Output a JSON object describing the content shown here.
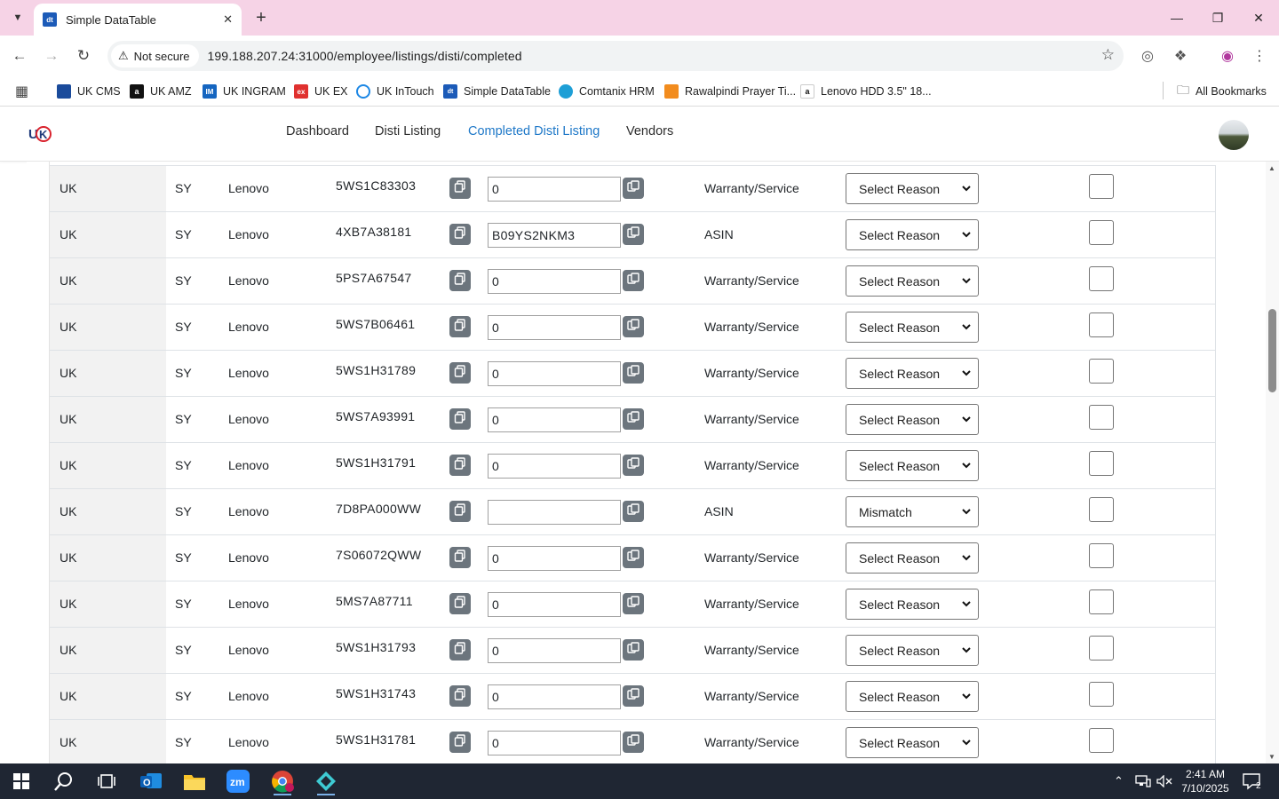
{
  "browser": {
    "tab_title": "Simple DataTable",
    "tab_favicon": "dt",
    "address_security": "Not secure",
    "url": "199.188.207.24:31000/employee/listings/disti/completed"
  },
  "bookmarks": [
    {
      "label": "UK CMS",
      "icon": "uk-cms-icon",
      "color": "#1a4b9b",
      "glyph": "■"
    },
    {
      "label": "UK AMZ",
      "icon": "amazon-icon",
      "color": "#111111",
      "glyph": "a"
    },
    {
      "label": "UK INGRAM",
      "icon": "ingram-icon",
      "color": "#1565c0",
      "glyph": "IM"
    },
    {
      "label": "UK EX",
      "icon": "ex-icon",
      "color": "#e0312f",
      "glyph": "ex"
    },
    {
      "label": "UK InTouch",
      "icon": "intouch-icon",
      "color": "#1e88e5",
      "glyph": "○"
    },
    {
      "label": "Simple DataTable",
      "icon": "datatable-icon",
      "color": "#1c5bb8",
      "glyph": "dt"
    },
    {
      "label": "Comtanix HRM",
      "icon": "comtanix-icon",
      "color": "#1e9fd6",
      "glyph": "●"
    },
    {
      "label": "Rawalpindi Prayer Ti...",
      "icon": "prayer-icon",
      "color": "#f28c1e",
      "glyph": "▓"
    },
    {
      "label": "Lenovo HDD 3.5\" 18...",
      "icon": "amazon-icon",
      "color": "#111111",
      "glyph": "a"
    }
  ],
  "all_bookmarks": "All Bookmarks",
  "nav": {
    "dashboard": "Dashboard",
    "disti_listing": "Disti Listing",
    "completed_disti_listing": "Completed Disti Listing",
    "vendors": "Vendors"
  },
  "rows": [
    {
      "country": "UK",
      "code": "SY",
      "brand": "Lenovo",
      "part": "5WS1C83303",
      "asin": "0",
      "type": "Warranty/Service",
      "reason": "Select Reason"
    },
    {
      "country": "UK",
      "code": "SY",
      "brand": "Lenovo",
      "part": "4XB7A38181",
      "asin": "B09YS2NKM3",
      "type": "ASIN",
      "reason": "Select Reason"
    },
    {
      "country": "UK",
      "code": "SY",
      "brand": "Lenovo",
      "part": "5PS7A67547",
      "asin": "0",
      "type": "Warranty/Service",
      "reason": "Select Reason"
    },
    {
      "country": "UK",
      "code": "SY",
      "brand": "Lenovo",
      "part": "5WS7B06461",
      "asin": "0",
      "type": "Warranty/Service",
      "reason": "Select Reason"
    },
    {
      "country": "UK",
      "code": "SY",
      "brand": "Lenovo",
      "part": "5WS1H31789",
      "asin": "0",
      "type": "Warranty/Service",
      "reason": "Select Reason"
    },
    {
      "country": "UK",
      "code": "SY",
      "brand": "Lenovo",
      "part": "5WS7A93991",
      "asin": "0",
      "type": "Warranty/Service",
      "reason": "Select Reason"
    },
    {
      "country": "UK",
      "code": "SY",
      "brand": "Lenovo",
      "part": "5WS1H31791",
      "asin": "0",
      "type": "Warranty/Service",
      "reason": "Select Reason"
    },
    {
      "country": "UK",
      "code": "SY",
      "brand": "Lenovo",
      "part": "7D8PA000WW",
      "asin": "",
      "type": "ASIN",
      "reason": "Mismatch"
    },
    {
      "country": "UK",
      "code": "SY",
      "brand": "Lenovo",
      "part": "7S06072QWW",
      "asin": "0",
      "type": "Warranty/Service",
      "reason": "Select Reason"
    },
    {
      "country": "UK",
      "code": "SY",
      "brand": "Lenovo",
      "part": "5MS7A87711",
      "asin": "0",
      "type": "Warranty/Service",
      "reason": "Select Reason"
    },
    {
      "country": "UK",
      "code": "SY",
      "brand": "Lenovo",
      "part": "5WS1H31793",
      "asin": "0",
      "type": "Warranty/Service",
      "reason": "Select Reason"
    },
    {
      "country": "UK",
      "code": "SY",
      "brand": "Lenovo",
      "part": "5WS1H31743",
      "asin": "0",
      "type": "Warranty/Service",
      "reason": "Select Reason"
    },
    {
      "country": "UK",
      "code": "SY",
      "brand": "Lenovo",
      "part": "5WS1H31781",
      "asin": "0",
      "type": "Warranty/Service",
      "reason": "Select Reason"
    }
  ],
  "taskbar": {
    "time": "2:41 AM",
    "date": "7/10/2025",
    "notifications": "2"
  },
  "colors": {
    "accent_link": "#1e78c8",
    "tabbar": "#f6d3e6",
    "copy_button": "#6c757d",
    "taskbar": "#1f2633"
  }
}
